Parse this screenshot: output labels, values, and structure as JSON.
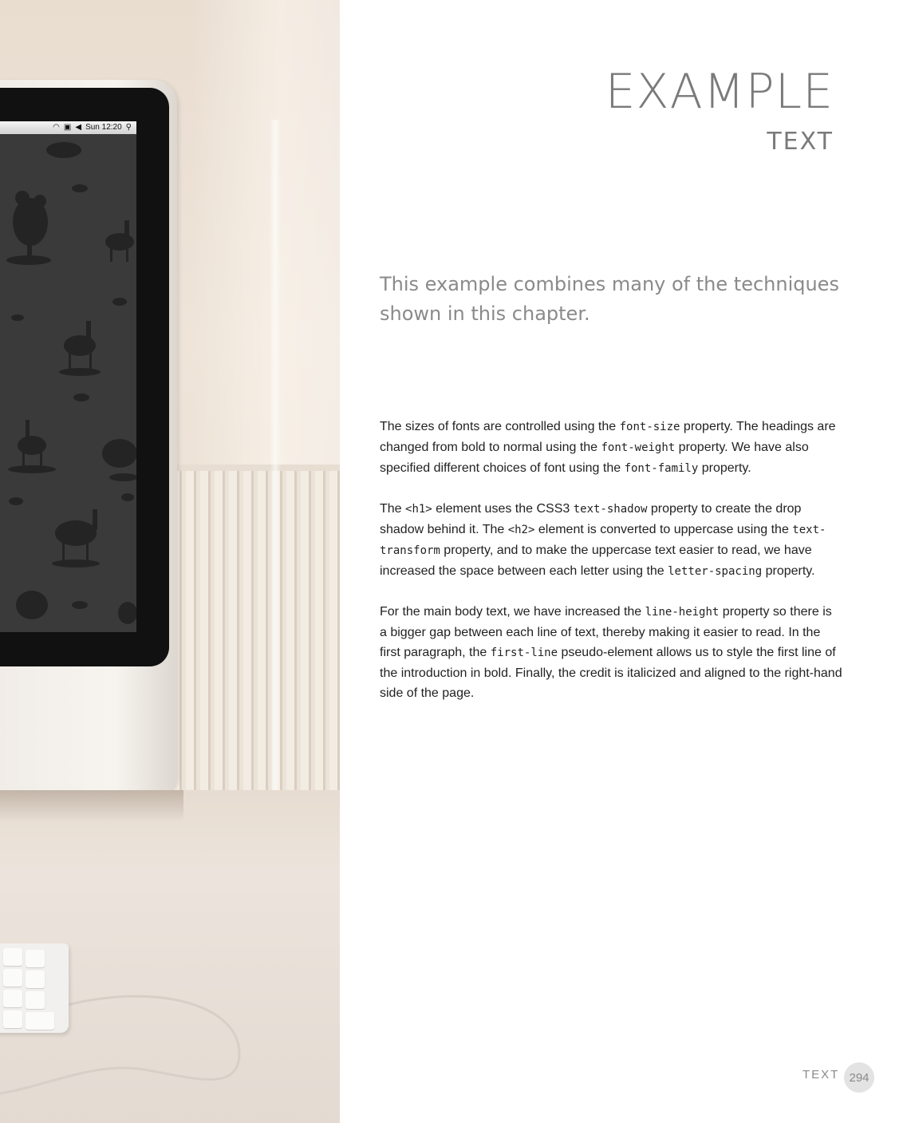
{
  "photo": {
    "menubar": {
      "clock": "Sun 12:20"
    }
  },
  "heading": {
    "title": "EXAMPLE",
    "subtitle": "TEXT"
  },
  "intro": "This example combines many of the techniques shown in this chapter.",
  "paragraphs": {
    "p1": {
      "t1": "The sizes of fonts are controlled using the ",
      "c1": "font-size",
      "t2": " property. The headings are changed from bold to normal using the ",
      "c2": "font-weight",
      "t3": " property. We have also specified different choices of font using the ",
      "c3": "font-family",
      "t4": " property."
    },
    "p2": {
      "t1": "The ",
      "c1": "<h1>",
      "t2": " element uses the CSS3 ",
      "c2": "text-shadow",
      "t3": " property to create the drop shadow behind it. The ",
      "c3": "<h2>",
      "t4": " element is converted to uppercase using the ",
      "c4": "text-transform",
      "t5": " property, and to make the uppercase text easier to read, we have increased the space between each letter using the ",
      "c5": "letter-spacing",
      "t6": " property."
    },
    "p3": {
      "t1": "For the main body text, we have increased the ",
      "c1": "line-height",
      "t2": " property so there is a bigger gap between each line of text, thereby making it easier to read. In the first paragraph, the ",
      "c2": "first-line",
      "t3": " pseudo-element allows us to style the first line of the introduction in bold. Finally, the credit is italicized and aligned to the right-hand side of the page."
    }
  },
  "footer": {
    "section": "TEXT",
    "page": "294"
  }
}
